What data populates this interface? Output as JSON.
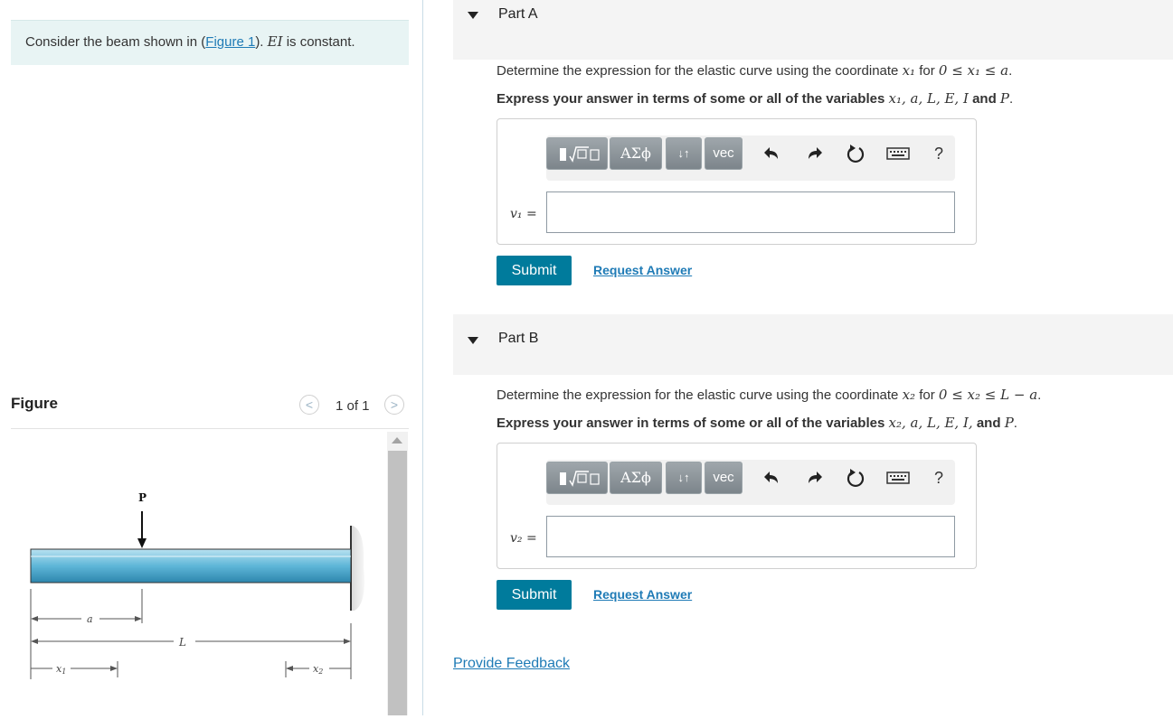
{
  "intro": {
    "text_before": "Consider the beam shown in (",
    "figure_link": "Figure 1",
    "text_mid": "). ",
    "ei": "EI",
    "text_after": " is constant."
  },
  "figure_panel": {
    "title": "Figure",
    "counter": "1 of 1",
    "prev_symbol": "<",
    "next_symbol": ">",
    "diagram_labels": {
      "load": "P",
      "a": "a",
      "L": "L",
      "x1": "x",
      "x1_sub": "1",
      "x2": "x",
      "x2_sub": "2"
    }
  },
  "part_a": {
    "title": "Part A",
    "question_pre": "Determine the expression for the elastic curve using the coordinate ",
    "question_var": "x₁",
    "question_for": " for ",
    "question_range": "0 ≤ x₁ ≤ a",
    "question_end": ".",
    "instr_pre": "Express your answer in terms of some or all of the variables ",
    "instr_vars": "x₁, a, L, E, I",
    "instr_and": " and ",
    "instr_last": "P",
    "instr_end": ".",
    "var_label": "v₁ =",
    "input_value": "",
    "submit": "Submit",
    "request": "Request Answer"
  },
  "part_b": {
    "title": "Part B",
    "question_pre": "Determine the expression for the elastic curve using the coordinate ",
    "question_var": "x₂",
    "question_for": " for ",
    "question_range": "0 ≤ x₂ ≤ L − a",
    "question_end": ".",
    "instr_pre": "Express your answer in terms of some or all of the variables ",
    "instr_vars": "x₂, a, L, E, I,",
    "instr_and": " and ",
    "instr_last": "P",
    "instr_end": ".",
    "var_label": "v₂ =",
    "input_value": "",
    "submit": "Submit",
    "request": "Request Answer"
  },
  "toolbar": {
    "greek": "ΑΣϕ",
    "arrows": "↓↑",
    "vec": "vec",
    "help": "?"
  },
  "feedback": "Provide Feedback",
  "colors": {
    "submit_bg": "#007b9c",
    "link": "#1f7bb6",
    "intro_bg": "#e8f4f4",
    "beam": "#5eb6d8"
  }
}
